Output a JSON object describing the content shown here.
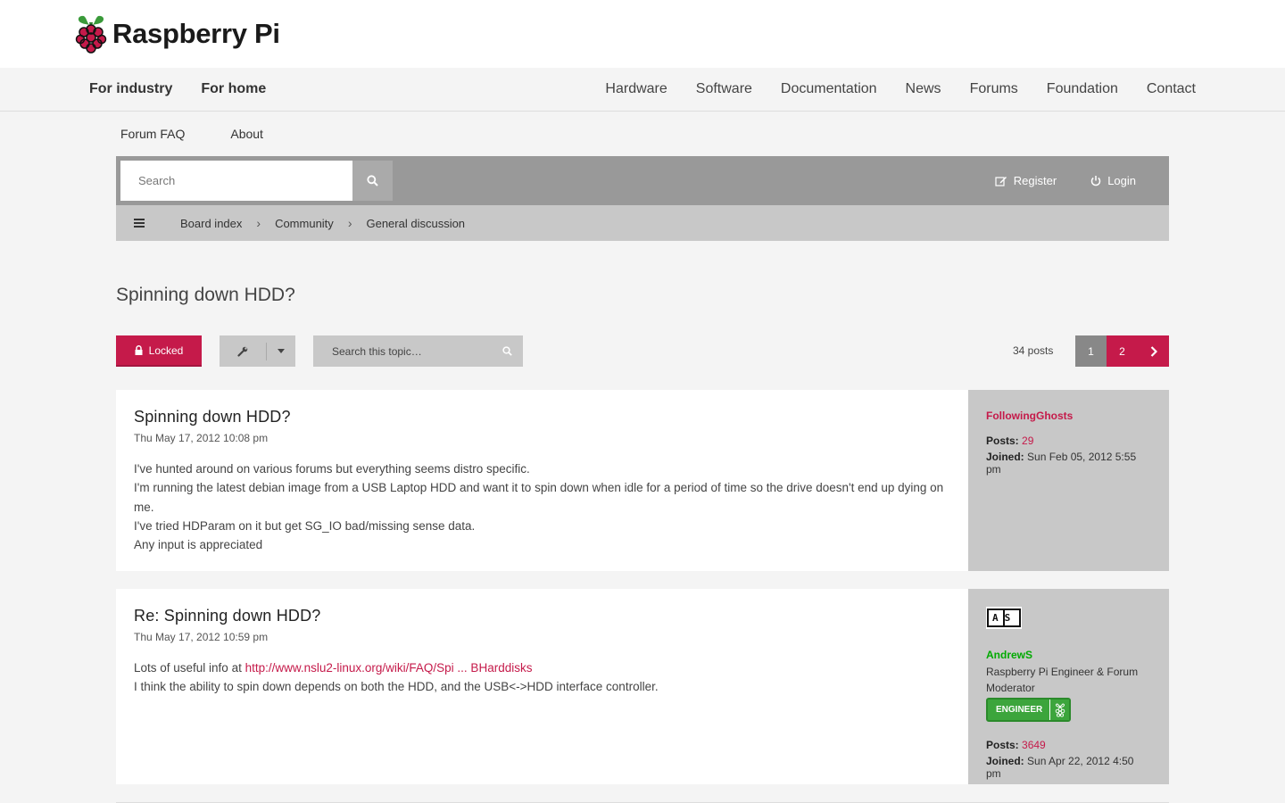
{
  "brand": {
    "name": "Raspberry Pi"
  },
  "main_nav": {
    "left": [
      "For industry",
      "For home"
    ],
    "right": [
      "Hardware",
      "Software",
      "Documentation",
      "News",
      "Forums",
      "Foundation",
      "Contact"
    ]
  },
  "sub_nav": [
    "Forum FAQ",
    "About"
  ],
  "search": {
    "placeholder": "Search"
  },
  "header_links": {
    "register": "Register",
    "login": "Login"
  },
  "breadcrumb": [
    "Board index",
    "Community",
    "General discussion"
  ],
  "topic": {
    "title": "Spinning down HDD?",
    "locked_label": "Locked",
    "search_placeholder": "Search this topic…",
    "post_count": "34 posts",
    "pages": [
      "1",
      "2"
    ]
  },
  "posts": [
    {
      "title": "Spinning down HDD?",
      "date": "Thu May 17, 2012 10:08 pm",
      "lines": [
        "I've hunted around on various forums but everything seems distro specific.",
        "I'm running the latest debian image from a USB Laptop HDD and want it to spin down when idle for a period of time so the drive doesn't end up dying on me.",
        "I've tried HDParam on it but get SG_IO bad/missing sense data.",
        "Any input is appreciated"
      ],
      "author": {
        "name": "FollowingGhosts",
        "posts_label": "Posts:",
        "posts": "29",
        "joined_label": "Joined:",
        "joined": "Sun Feb 05, 2012 5:55 pm"
      }
    },
    {
      "title": "Re: Spinning down HDD?",
      "date": "Thu May 17, 2012 10:59 pm",
      "line1_prefix": "Lots of useful info at ",
      "link": "http://www.nslu2-linux.org/wiki/FAQ/Spi ... BHarddisks",
      "line2": "I think the ability to spin down depends on both the HDD, and the USB<->HDD interface controller.",
      "author": {
        "avatar_text": "AS",
        "name": "AndrewS",
        "rank": "Raspberry Pi Engineer & Forum Moderator",
        "badge": "ENGINEER",
        "posts_label": "Posts:",
        "posts": "3649",
        "joined_label": "Joined:",
        "joined": "Sun Apr 22, 2012 4:50 pm"
      }
    }
  ],
  "colors": {
    "accent": "#c51a4a",
    "moderator": "#00aa00",
    "panel": "#c8c8c8"
  }
}
